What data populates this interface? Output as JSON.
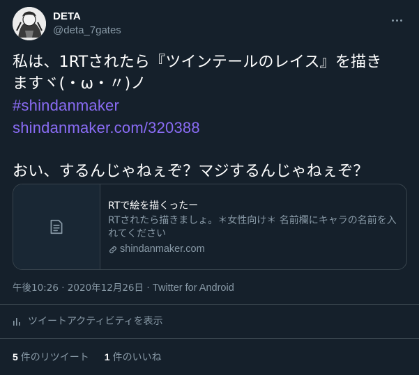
{
  "author": {
    "display_name": "DETA",
    "handle": "@deta_7gates"
  },
  "tweet": {
    "line1": "私は、1RTされたら『ツインテールのレイス』を描き",
    "line2": "ますヾ(・ω・〃)ノ",
    "hashtag": "#shindanmaker",
    "url": "shindanmaker.com/320388",
    "line5": "おい、するんじゃねぇぞ？マジするんじゃねぇぞ？"
  },
  "card": {
    "title": "RTで絵を描くったー",
    "description": "RTされたら描きましょ。＊女性向け＊ 名前欄にキャラの名前を入れてください",
    "domain": "shindanmaker.com"
  },
  "meta": {
    "time": "午後10:26",
    "dot1": "·",
    "date": "2020年12月26日",
    "dot2": "·",
    "source": "Twitter for Android"
  },
  "activity_label": "ツイートアクティビティを表示",
  "stats": {
    "retweets_count": "5",
    "retweets_label": "件のリツイート",
    "likes_count": "1",
    "likes_label": "件のいいね"
  },
  "colors": {
    "background": "#15202b",
    "link": "#8a6cf5",
    "secondary_text": "#8899a6",
    "border": "#38444d"
  }
}
